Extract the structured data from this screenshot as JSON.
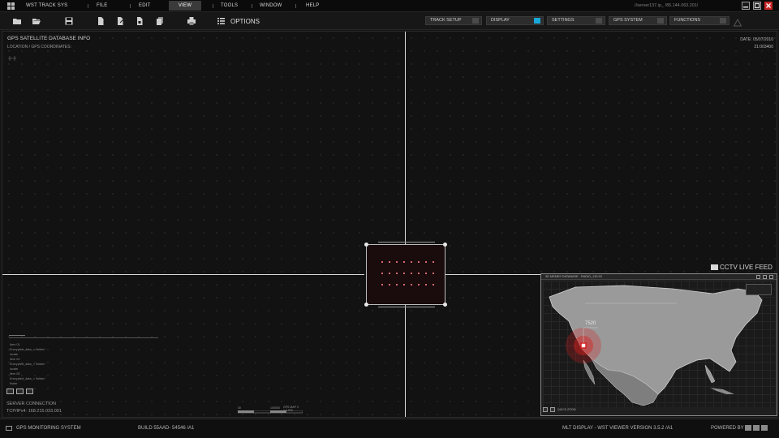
{
  "app": {
    "name": "WST TRACK SYS",
    "address": "//server137.ip_ /85.144.063.201/"
  },
  "menu": [
    "FILE",
    "EDIT",
    "VIEW",
    "TOOLS",
    "WINDOW",
    "HELP"
  ],
  "menu_active": "VIEW",
  "toolbar": {
    "options_label": "OPTIONS",
    "tools": [
      "folder-icon",
      "open-folder-icon",
      "save-icon",
      "document-icon",
      "document-edit-icon",
      "document-copy-icon",
      "documents-icon",
      "print-icon"
    ],
    "buttons": [
      {
        "label": "TRACK SETUP",
        "active": false
      },
      {
        "label": "DISPLAY",
        "active": true
      },
      {
        "label": "SETTINGS",
        "active": false
      },
      {
        "label": "GPS SYSTEM",
        "active": false
      },
      {
        "label": "FUNCTIONS",
        "active": false
      }
    ]
  },
  "viewport": {
    "title": "GPS SATELLITE DATABASE INFO",
    "subtitle": "LOCATION / GPS COORDINATES:",
    "date": "DATE: 05/07/2010",
    "time": "21:003400",
    "feed_label": "CCTV LIVE FEED"
  },
  "map_window": {
    "title": "3D MEMES DATABASE - RADIO_133.93",
    "target_value": "7520",
    "zoom_label": "QUICK ZOOM"
  },
  "lower_left": {
    "list": [
      "Item 01",
      "Encrypted_data_< /folder/",
      "locate",
      "item 04",
      "Encrypted_data_< /folder/",
      "locate",
      "item 05",
      "Encrypted_data_< /folder/",
      "finder"
    ],
    "connection": "SERVER CONNECTION",
    "ip": "TCP/IPv4: 168.215.033.001",
    "scale_left": "30",
    "scale_right": "100000",
    "scale_caption": "GPS MAP V 1.4.900"
  },
  "statusbar": {
    "left": "GPS MONITORING SYSTEM",
    "build": "BUILD 55AAD- 54546 /A1",
    "version": "MLT DISPLAY - WST VIEWER VERSION 3.5.2 /A1",
    "powered": "POWERED BY"
  },
  "colors": {
    "accent": "#19a7d8",
    "close": "#c72525",
    "target_red": "#d42020"
  }
}
